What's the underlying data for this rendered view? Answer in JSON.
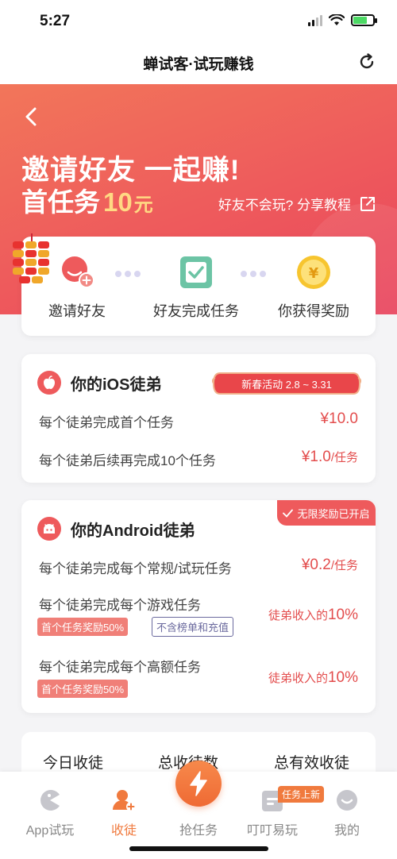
{
  "status": {
    "time": "5:27"
  },
  "nav": {
    "title": "蝉试客·试玩赚钱"
  },
  "banner": {
    "headline1": "邀请好友 一起赚!",
    "headline2_prefix": "首任务",
    "headline2_amount": "10",
    "headline2_unit": "元",
    "tutorial_text": "好友不会玩? 分享教程"
  },
  "steps": [
    {
      "label": "邀请好友",
      "icon": "invite-user-icon"
    },
    {
      "label": "好友完成任务",
      "icon": "task-check-icon"
    },
    {
      "label": "你获得奖励",
      "icon": "yen-coin-icon"
    }
  ],
  "ios_card": {
    "title": "你的iOS徒弟",
    "badge": "新春活动 2.8 ~ 3.31",
    "rows": [
      {
        "label": "每个徒弟完成首个任务",
        "value": "¥10.0",
        "unit": ""
      },
      {
        "label": "每个徒弟后续再完成10个任务",
        "value": "¥1.0",
        "unit": "/任务"
      }
    ]
  },
  "android_card": {
    "title": "你的Android徒弟",
    "corner_badge": "无限奖励已开启",
    "row1": {
      "label": "每个徒弟完成每个常规/试玩任务",
      "value": "¥0.2",
      "unit": "/任务"
    },
    "row2": {
      "label": "每个徒弟完成每个游戏任务",
      "tag1": "首个任务奖励50%",
      "tag2": "不含榜单和充值",
      "value_prefix": "徒弟收入的",
      "value": "10%"
    },
    "row3": {
      "label": "每个徒弟完成每个高额任务",
      "tag1": "首个任务奖励50%",
      "value_prefix": "徒弟收入的",
      "value": "10%"
    }
  },
  "stats": {
    "today": "今日收徒",
    "total": "总收徒数",
    "valid": "总有效收徒"
  },
  "tabs": [
    {
      "label": "App试玩",
      "icon": "pacman-icon",
      "active": false
    },
    {
      "label": "收徒",
      "icon": "add-user-icon",
      "active": true
    },
    {
      "label": "抢任务",
      "icon": "lightning-icon",
      "active": false
    },
    {
      "label": "叮叮易玩",
      "icon": "dingding-icon",
      "active": false
    },
    {
      "label": "我的",
      "icon": "profile-icon",
      "active": false
    }
  ],
  "tab_badge": "任务上新",
  "colors": {
    "accent": "#ee5a5c",
    "tab_active": "#f07a3e",
    "gold": "#ffd983"
  }
}
